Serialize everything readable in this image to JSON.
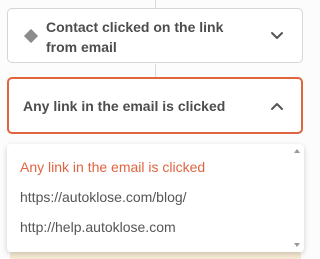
{
  "trigger": {
    "label": "Contact clicked on the link from email",
    "icon": "diamond-icon",
    "expand_icon": "chevron-down-icon"
  },
  "condition": {
    "label": "Any link in the email is clicked",
    "collapse_icon": "chevron-up-icon",
    "accent_color": "#e0643f"
  },
  "dropdown": {
    "options": [
      "Any link in the email is clicked",
      "https://autoklose.com/blog/",
      "http://help.autoklose.com"
    ],
    "selected_index": 0
  }
}
